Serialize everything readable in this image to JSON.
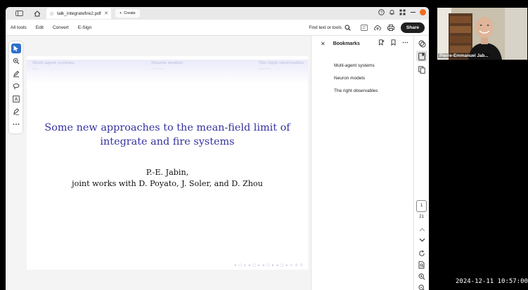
{
  "browser": {
    "tab_title": "talk_integratefire2.pdf",
    "new_tab_label": "Create"
  },
  "menu": {
    "items": [
      "All tools",
      "Edit",
      "Convert",
      "E-Sign"
    ],
    "find_text": "Find text or tools",
    "share_label": "Share"
  },
  "slide": {
    "nav_sections": [
      "Multi-agent systems",
      "Neuron models",
      "The right observables"
    ],
    "nav_dots": [
      "○○○",
      "○○○○○○",
      "○○○○○○"
    ],
    "title_line1": "Some new approaches to the mean-field limit of",
    "title_line2": "integrate and fire systems",
    "author_line1": "P.-E. Jabin,",
    "author_line2": "joint works with D. Poyato, J. Soler, and D. Zhou"
  },
  "bookmarks": {
    "title": "Bookmarks",
    "items": [
      "Multi-agent systems",
      "Neuron models",
      "The right observables"
    ]
  },
  "pager": {
    "current_page": "1",
    "total_pages": "21"
  },
  "webcam": {
    "name": "Pierre-Emmanuel Jab..."
  },
  "timestamp": "2024-12-11  10:57:00",
  "colors": {
    "slide_title": "#3333a0",
    "active_tool": "#2c6ecb",
    "share_button": "#1f1f1f"
  }
}
